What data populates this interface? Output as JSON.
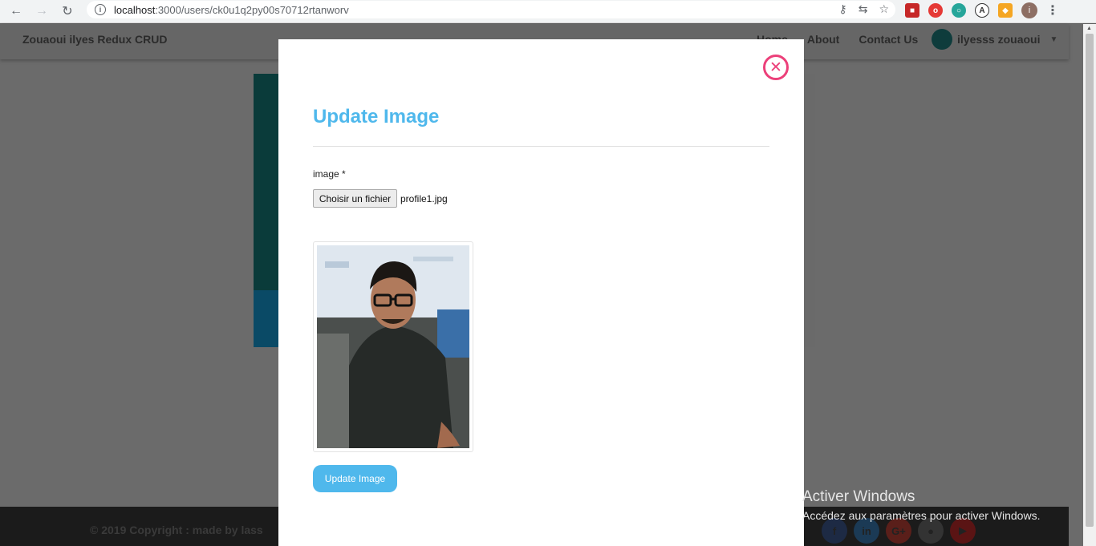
{
  "browser": {
    "url_host": "localhost",
    "url_path": ":3000/users/ck0u1q2py00s70712rtanworv",
    "profile_initial": "i"
  },
  "app": {
    "brand": "Zouaoui ilyes Redux CRUD",
    "nav_links": [
      "Home",
      "About",
      "Contact Us"
    ],
    "user_name": "ilyesss zouaoui",
    "footer_copyright": "© 2019 Copyright : made by lass",
    "social": [
      "f",
      "in",
      "G+",
      "github",
      "You Tube"
    ]
  },
  "modal": {
    "title": "Update Image",
    "field_label": "image *",
    "file_button_label": "Choisir un fichier",
    "file_name": "profile1.jpg",
    "submit_label": "Update Image",
    "close_icon": "close-circle-icon"
  },
  "windows_watermark": {
    "title": "Activer Windows",
    "subtitle": "Accédez aux paramètres pour activer Windows."
  },
  "colors": {
    "accent": "#4fb8ec",
    "close": "#ec407a"
  }
}
